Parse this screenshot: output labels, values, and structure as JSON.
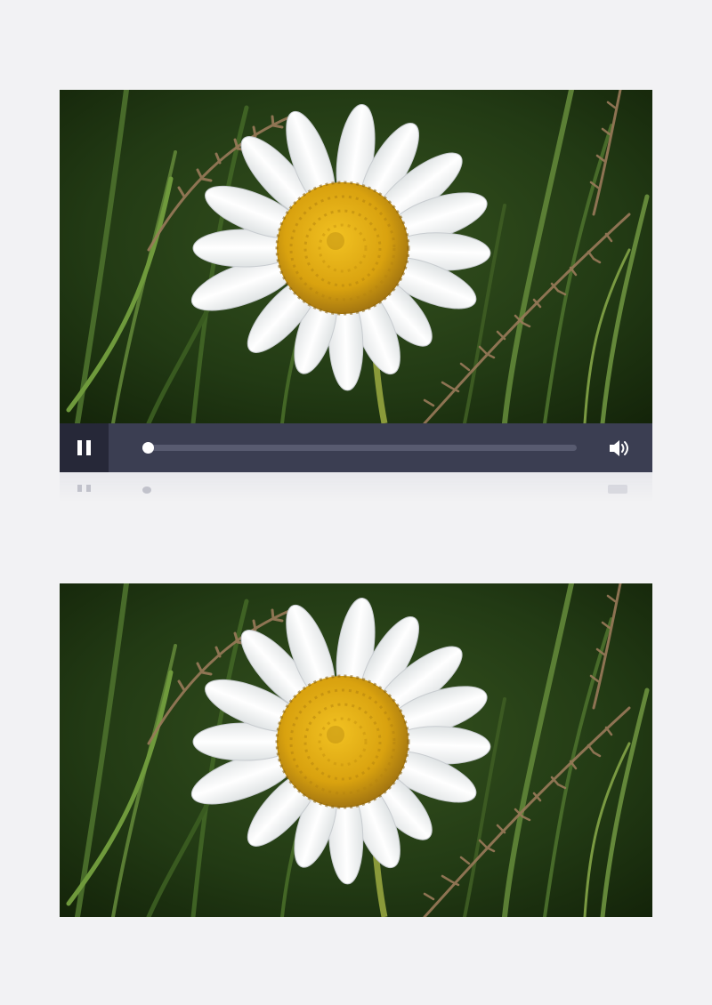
{
  "player": {
    "state": "playing",
    "progress_fraction": 0.01,
    "play_pause_icon": "pause-icon",
    "volume_icon": "speaker-volume-icon"
  },
  "colors": {
    "page_background": "#f2f2f4",
    "control_bar": "#3b3e52",
    "play_button_background": "#262838",
    "track": "#585b70",
    "knob": "#ffffff"
  },
  "frames": [
    {
      "subject": "white-daisy-flower"
    },
    {
      "subject": "white-daisy-flower"
    }
  ]
}
